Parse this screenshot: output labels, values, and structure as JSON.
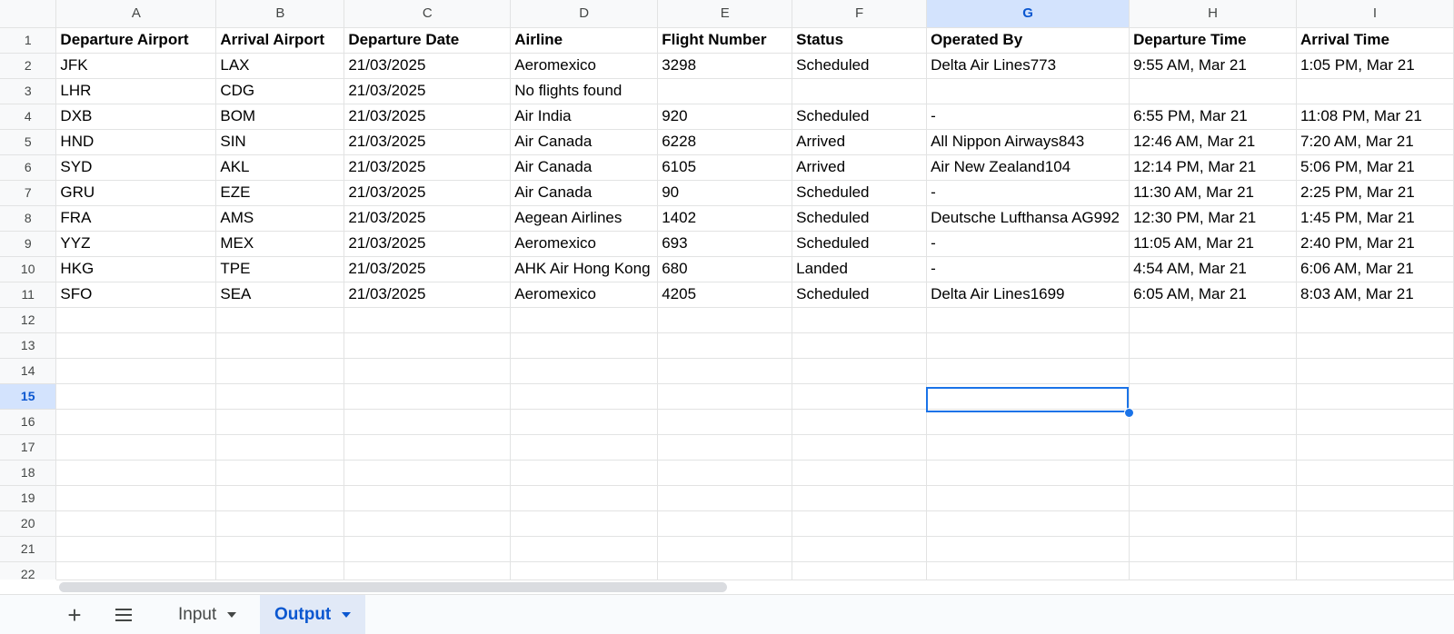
{
  "columns": [
    "A",
    "B",
    "C",
    "D",
    "E",
    "F",
    "G",
    "H",
    "I"
  ],
  "rows": [
    [
      "Departure Airport",
      "Arrival Airport",
      "Departure Date",
      "Airline",
      "Flight Number",
      "Status",
      "Operated By",
      "Departure Time",
      "Arrival Time"
    ],
    [
      "JFK",
      "LAX",
      "21/03/2025",
      "Aeromexico",
      "3298",
      "Scheduled",
      "Delta Air Lines773",
      "9:55 AM, Mar 21",
      "1:05 PM, Mar 21"
    ],
    [
      "LHR",
      "CDG",
      "21/03/2025",
      "No flights found",
      "",
      "",
      "",
      "",
      ""
    ],
    [
      "DXB",
      "BOM",
      "21/03/2025",
      "Air India",
      "920",
      "Scheduled",
      "-",
      "6:55 PM, Mar 21",
      "11:08 PM, Mar 21"
    ],
    [
      "HND",
      "SIN",
      "21/03/2025",
      "Air Canada",
      "6228",
      "Arrived",
      "All Nippon Airways843",
      "12:46 AM, Mar 21",
      "7:20 AM, Mar 21"
    ],
    [
      "SYD",
      "AKL",
      "21/03/2025",
      "Air Canada",
      "6105",
      "Arrived",
      "Air New Zealand104",
      "12:14 PM, Mar 21",
      "5:06 PM, Mar 21"
    ],
    [
      "GRU",
      "EZE",
      "21/03/2025",
      "Air Canada",
      "90",
      "Scheduled",
      "-",
      "11:30 AM, Mar 21",
      "2:25 PM, Mar 21"
    ],
    [
      "FRA",
      "AMS",
      "21/03/2025",
      "Aegean Airlines",
      "1402",
      "Scheduled",
      "Deutsche Lufthansa AG992",
      "12:30 PM, Mar 21",
      "1:45 PM, Mar 21"
    ],
    [
      "YYZ",
      "MEX",
      "21/03/2025",
      "Aeromexico",
      "693",
      "Scheduled",
      "-",
      "11:05 AM, Mar 21",
      "2:40 PM, Mar 21"
    ],
    [
      "HKG",
      "TPE",
      "21/03/2025",
      "AHK Air Hong Kong",
      "680",
      "Landed",
      "-",
      "4:54 AM, Mar 21",
      "6:06 AM, Mar 21"
    ],
    [
      "SFO",
      "SEA",
      "21/03/2025",
      "Aeromexico",
      "4205",
      "Scheduled",
      "Delta Air Lines1699",
      "6:05 AM, Mar 21",
      "8:03 AM, Mar 21"
    ],
    [
      "",
      "",
      "",
      "",
      "",
      "",
      "",
      "",
      ""
    ],
    [
      "",
      "",
      "",
      "",
      "",
      "",
      "",
      "",
      ""
    ],
    [
      "",
      "",
      "",
      "",
      "",
      "",
      "",
      "",
      ""
    ],
    [
      "",
      "",
      "",
      "",
      "",
      "",
      "",
      "",
      ""
    ],
    [
      "",
      "",
      "",
      "",
      "",
      "",
      "",
      "",
      ""
    ],
    [
      "",
      "",
      "",
      "",
      "",
      "",
      "",
      "",
      ""
    ],
    [
      "",
      "",
      "",
      "",
      "",
      "",
      "",
      "",
      ""
    ],
    [
      "",
      "",
      "",
      "",
      "",
      "",
      "",
      "",
      ""
    ],
    [
      "",
      "",
      "",
      "",
      "",
      "",
      "",
      "",
      ""
    ],
    [
      "",
      "",
      "",
      "",
      "",
      "",
      "",
      "",
      ""
    ],
    [
      "",
      "",
      "",
      "",
      "",
      "",
      "",
      "",
      ""
    ]
  ],
  "row_numbers": [
    "1",
    "2",
    "3",
    "4",
    "5",
    "6",
    "7",
    "8",
    "9",
    "10",
    "11",
    "12",
    "13",
    "14",
    "15",
    "16",
    "17",
    "18",
    "19",
    "20",
    "21",
    "22"
  ],
  "active_cell": {
    "column": "G",
    "row": "15"
  },
  "sheet_tabs": [
    {
      "label": "Input",
      "active": false
    },
    {
      "label": "Output",
      "active": true
    }
  ],
  "icons": {
    "add_sheet": "plus-icon",
    "all_sheets": "menu-icon"
  },
  "colors": {
    "accent": "#1a73e8",
    "active_tab_text": "#0b57d0"
  }
}
